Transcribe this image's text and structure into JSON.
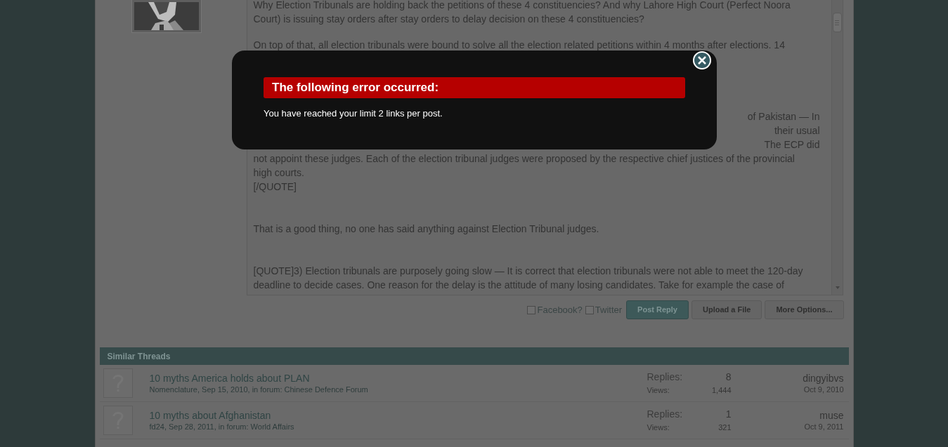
{
  "editor": {
    "paragraphs": [
      {
        "kind": "top",
        "lines": [
          {
            "kind": "full",
            "text": "Why Election Tribunals are holding back the petitions of these 4 constituencies? And why Lahore High Court (Perfect Noora"
          },
          {
            "kind": "full",
            "text": "Court) is issuing stay orders after stay orders to delay decision on these 4 constituencies?"
          }
        ]
      },
      {
        "kind": "follow",
        "lines": [
          {
            "kind": "full",
            "text": "On top of that, all election tribunals were bound to solve all the election related petitions within 4 months after elections. 14"
          },
          {
            "kind": "hidden"
          }
        ]
      },
      {
        "kind": "separate",
        "lines": [
          {
            "kind": "hidden"
          },
          {
            "kind": "tail",
            "text": "of Pakistan — In"
          },
          {
            "kind": "tail",
            "text": "their usual"
          },
          {
            "kind": "tail",
            "text": "The ECP did"
          },
          {
            "kind": "full",
            "text": "not appoint these judges. Each of the election tribunal judges were proposed by the respective chief justices of the provincial"
          },
          {
            "kind": "full",
            "text": "high courts."
          },
          {
            "kind": "full",
            "text": "[/QUOTE]"
          }
        ]
      },
      {
        "kind": "separate",
        "lines": [
          {
            "kind": "full",
            "text": "That is a good thing, no one has said anything against Election Tribunal judges."
          }
        ]
      },
      {
        "kind": "separate",
        "lines": [
          {
            "kind": "full",
            "text": "[QUOTE]3) Election tribunals are purposely going slow — It is correct that election tribunals were not able to meet the 120-day"
          },
          {
            "kind": "full",
            "text": "deadline to decide cases. One reason for the delay is the attitude of many losing candidates. Take for example the case of"
          }
        ]
      }
    ]
  },
  "share_options": [
    {
      "label": "Facebook?",
      "checked": false
    },
    {
      "label": "Twitter",
      "checked": false
    }
  ],
  "buttons": [
    {
      "label": "Post Reply",
      "kind": "primary"
    },
    {
      "label": "Upload a File",
      "kind": "secondary"
    },
    {
      "label": "More Options...",
      "kind": "secondary"
    }
  ],
  "similar_threads": {
    "title": "Similar Threads",
    "rows": [
      {
        "title": "10 myths America holds about PLAN",
        "meta": "Nomenclature, Sep 15, 2010, in forum: Chinese Defence Forum",
        "replies_label": "Replies:",
        "replies": "8",
        "views_label": "Views:",
        "views": "1,444",
        "last_poster": "dingyibvs",
        "last_date": "Oct 9, 2010"
      },
      {
        "title": "10 myths about Afghanistan",
        "meta": "fd24, Sep 28, 2011, in forum: World Affairs",
        "replies_label": "Replies:",
        "replies": "1",
        "views_label": "Views:",
        "views": "321",
        "last_poster": "muse",
        "last_date": "Oct 9, 2011"
      }
    ]
  },
  "error_dialog": {
    "title": "The following error occurred:",
    "message": "You have reached your limit 2 links per post."
  }
}
